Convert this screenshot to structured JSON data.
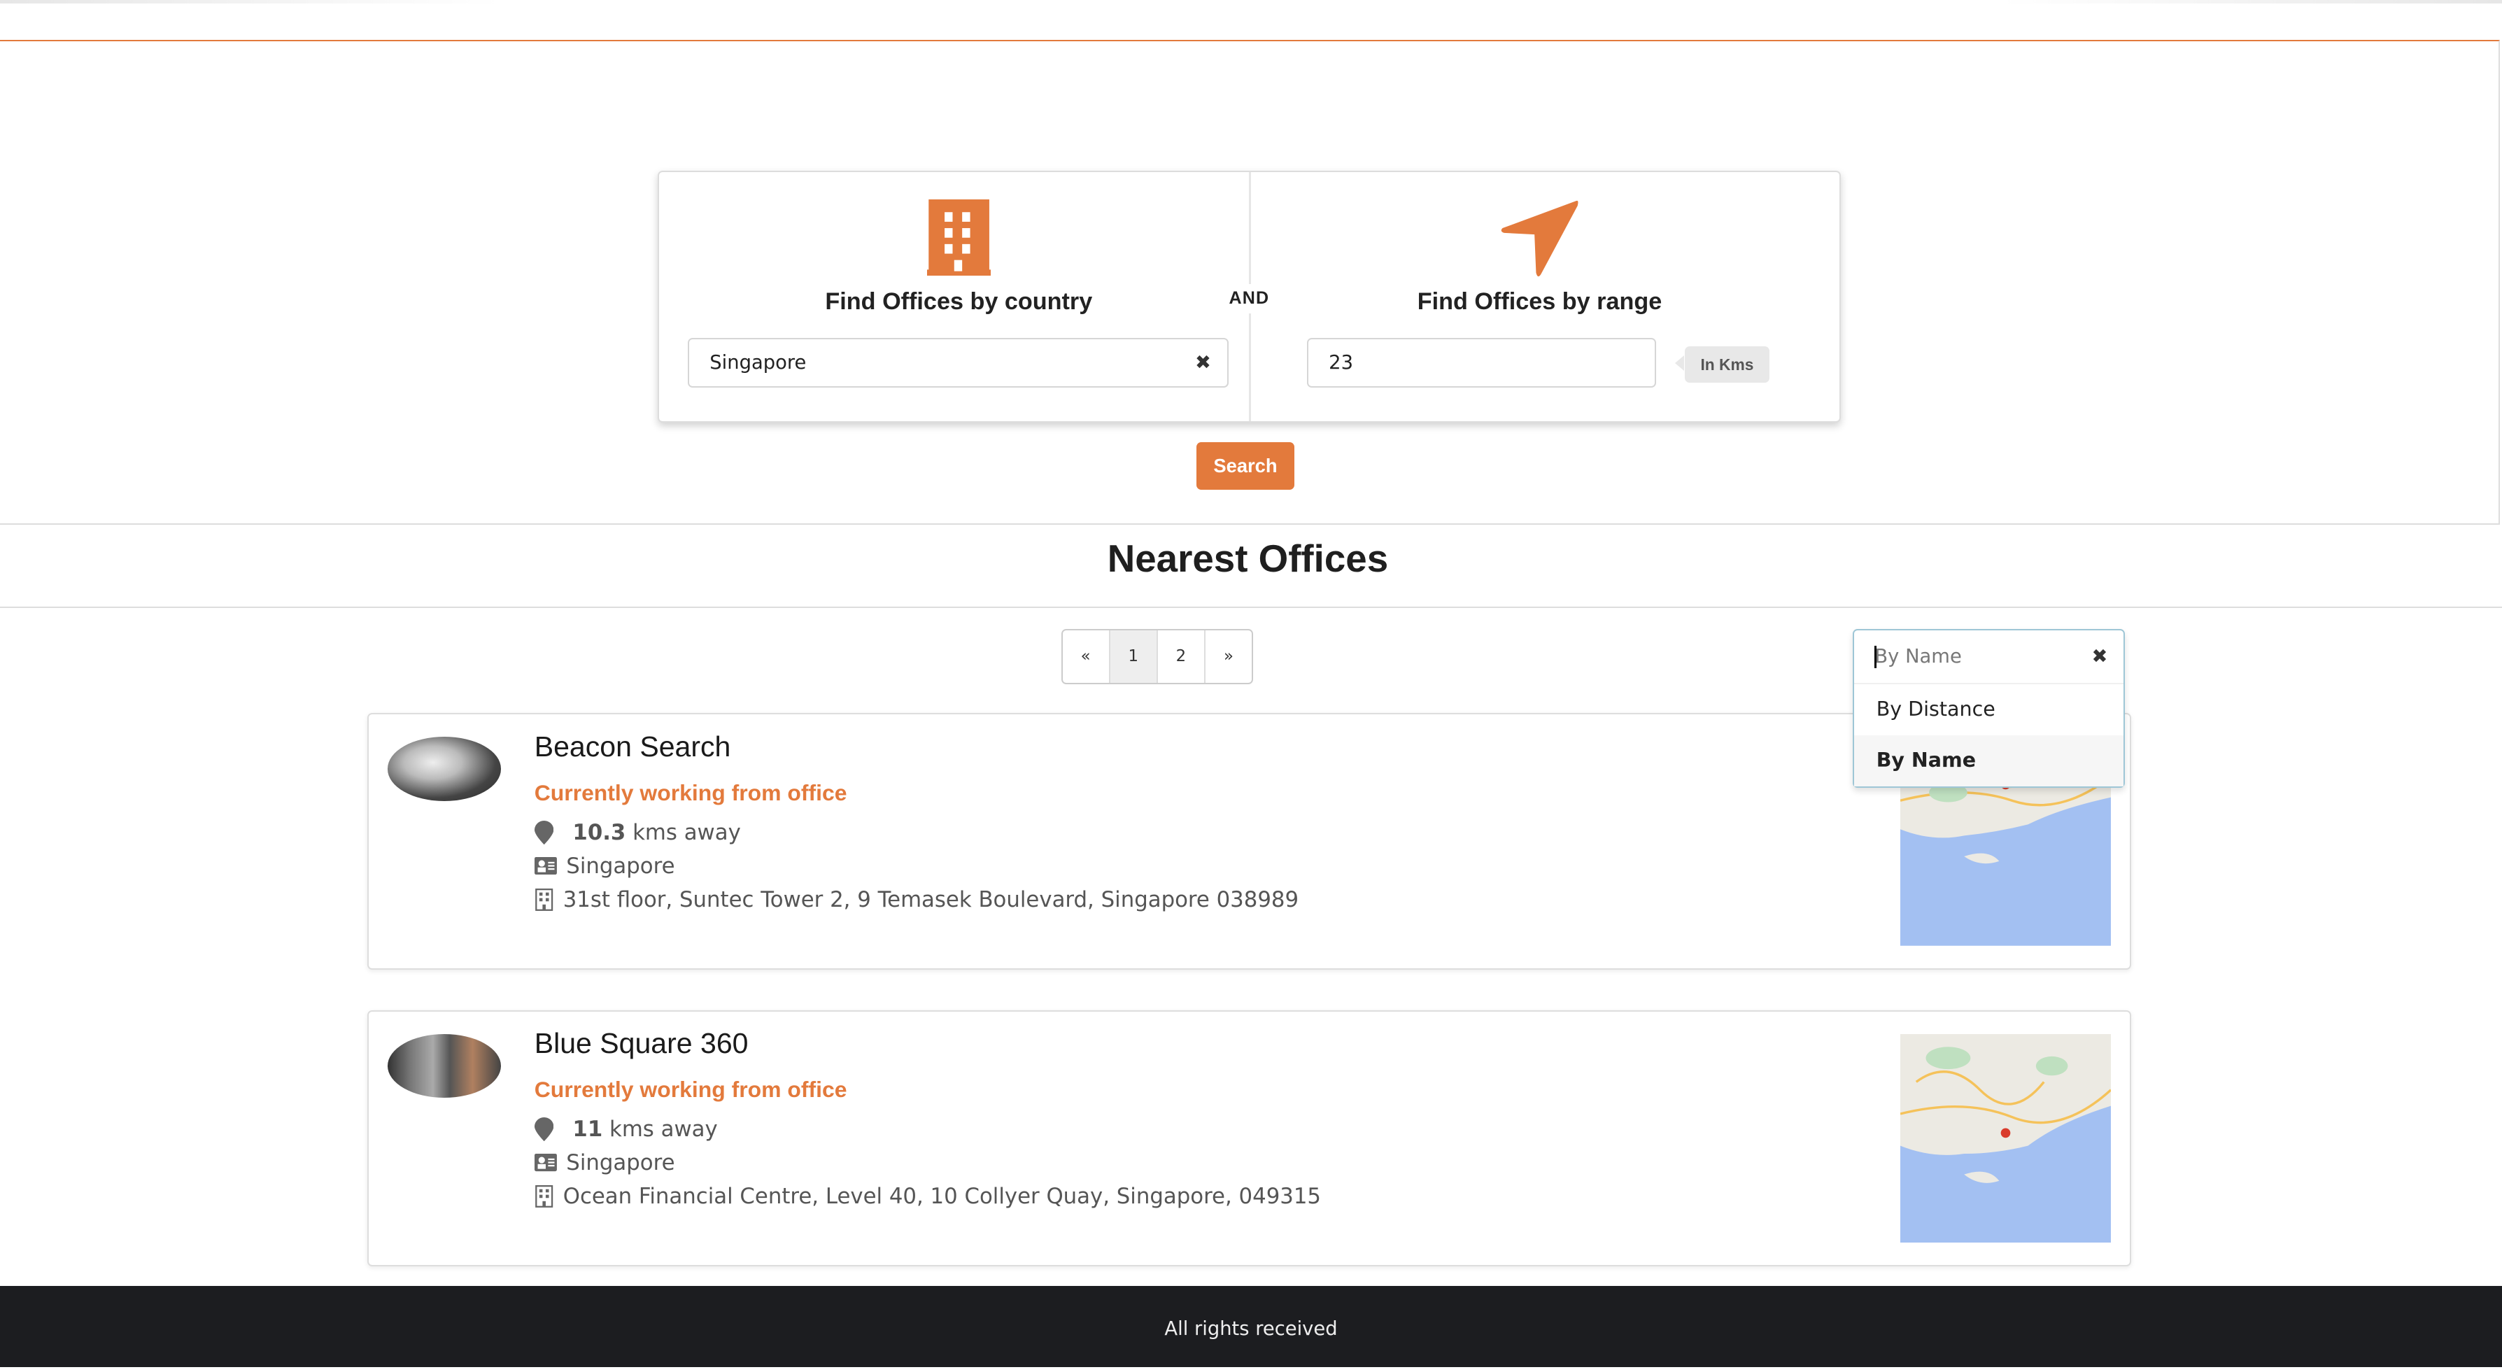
{
  "search_panel": {
    "country": {
      "title": "Find Offices by country",
      "value": "Singapore",
      "clear_icon": "times-icon",
      "icon": "building-icon"
    },
    "joiner": "AND",
    "range": {
      "title": "Find Offices by range",
      "value": "23",
      "unit": "In Kms",
      "icon": "location-arrow-icon"
    },
    "search_label": "Search"
  },
  "results": {
    "heading": "Nearest Offices",
    "pagination": {
      "prev": "«",
      "pages": [
        "1",
        "2"
      ],
      "next": "»",
      "current": "1"
    },
    "sort": {
      "placeholder": "By Name",
      "options": [
        "By Distance",
        "By Name"
      ],
      "selected": "By Name"
    },
    "offices": [
      {
        "name": "Beacon Search",
        "status": "Currently working from office",
        "distance": "10.3",
        "distance_unit": "kms away",
        "country": "Singapore",
        "address": "31st floor, Suntec Tower 2, 9 Temasek Boulevard, Singapore 038989"
      },
      {
        "name": "Blue Square 360",
        "status": "Currently working from office",
        "distance": "11",
        "distance_unit": "kms away",
        "country": "Singapore",
        "address": "Ocean Financial Centre, Level 40, 10 Collyer Quay, Singapore, 049315"
      }
    ]
  },
  "footer": {
    "text": "All rights received"
  },
  "colors": {
    "accent": "#e37a3c",
    "footer_bg": "#1c1d20"
  }
}
